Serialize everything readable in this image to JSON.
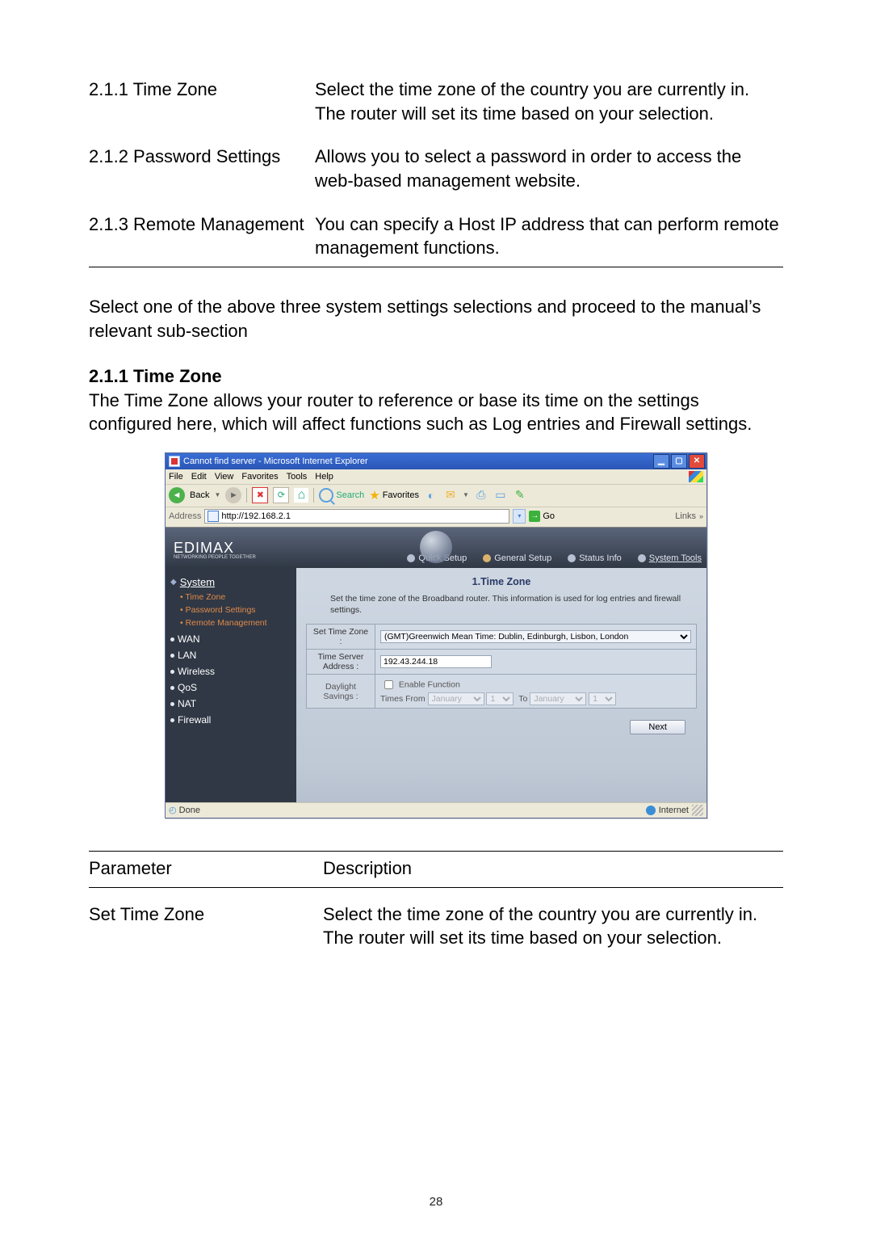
{
  "defs": [
    {
      "param": "2.1.1 Time Zone",
      "desc": "Select the time zone of the country you are currently in. The router will set its time based on your selection."
    },
    {
      "param": "2.1.2 Password Settings",
      "desc": "Allows you to select a password in order to access the web-based management website."
    },
    {
      "param": "2.1.3 Remote Management",
      "desc": "You can specify a Host IP address that can perform remote management functions."
    }
  ],
  "intro_text": "Select one of the above three system settings selections and proceed to the manual’s relevant sub-section",
  "section_heading": "2.1.1 Time Zone",
  "section_body": "The Time Zone allows your router to reference or base its time on the settings configured here, which will affect functions such as Log entries and Firewall settings.",
  "ie": {
    "title": "Cannot find server - Microsoft Internet Explorer",
    "menus": [
      "File",
      "Edit",
      "View",
      "Favorites",
      "Tools",
      "Help"
    ],
    "back_label": "Back",
    "search_label": "Search",
    "favorites_label": "Favorites",
    "address_label": "Address",
    "address_value": "http://192.168.2.1",
    "go_label": "Go",
    "links_label": "Links",
    "status_left": "Done",
    "status_right": "Internet"
  },
  "router": {
    "brand": "EDIMAX",
    "brand_tagline": "NETWORKING PEOPLE TOGETHER",
    "tabs": [
      "Quick Setup",
      "General Setup",
      "Status Info",
      "System Tools"
    ],
    "sidebar": {
      "system": "System",
      "subs": [
        "Time Zone",
        "Password Settings",
        "Remote Management"
      ],
      "items": [
        "WAN",
        "LAN",
        "Wireless",
        "QoS",
        "NAT",
        "Firewall"
      ]
    },
    "panel": {
      "title": "1.Time Zone",
      "desc": "Set the time zone of the Broadband router. This information is used for log entries and firewall settings.",
      "row_tz_label": "Set Time Zone :",
      "row_tz_value": "(GMT)Greenwich Mean Time: Dublin, Edinburgh, Lisbon, London",
      "row_ts_label": "Time Server Address :",
      "row_ts_value": "192.43.244.18",
      "row_ds_label": "Daylight Savings :",
      "row_ds_enable": "Enable Function",
      "row_ds_from": "Times From",
      "row_ds_to": "To",
      "month": "January",
      "day": "1",
      "next_btn": "Next"
    }
  },
  "param_table": {
    "head_param": "Parameter",
    "head_desc": "Description",
    "rows": [
      {
        "param": "Set Time Zone",
        "desc": "Select the time zone of the country you are currently in. The router will set its time based on your selection."
      }
    ]
  },
  "page_number": "28"
}
